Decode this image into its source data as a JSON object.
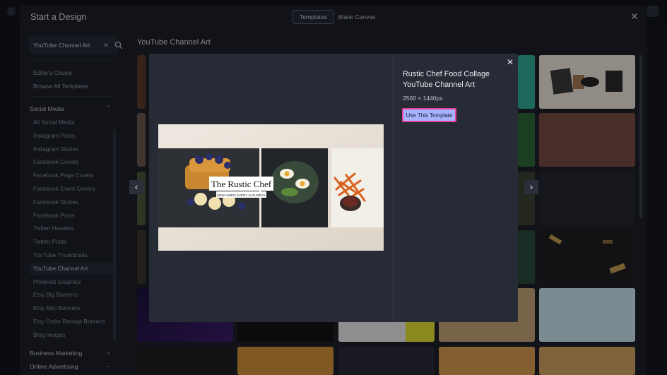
{
  "modal": {
    "title": "Start a Design",
    "tabs": [
      {
        "label": "Templates",
        "active": true
      },
      {
        "label": "Blank Canvas",
        "active": false
      }
    ]
  },
  "search": {
    "value": "YouTube Channel Art"
  },
  "sidebar": {
    "links": [
      "Editor's Choice",
      "Browse All Templates"
    ],
    "social_media": {
      "label": "Social Media",
      "items": [
        "All Social Media",
        "Instagram Posts",
        "Instagram Stories",
        "Facebook Covers",
        "Facebook Page Covers",
        "Facebook Event Covers",
        "Facebook Stories",
        "Facebook Posts",
        "Twitter Headers",
        "Twitter Posts",
        "YouTube Thumbnails",
        "YouTube Channel Art",
        "Pinterest Graphics",
        "Etsy Big Banners",
        "Etsy Mini Banners",
        "Etsy Order Receipt Banners",
        "Blog Images"
      ],
      "active_item": "YouTube Channel Art"
    },
    "collapsed_sections": [
      "Business Marketing",
      "Online Advertising"
    ]
  },
  "gallery": {
    "title": "YouTube Channel Art"
  },
  "preview": {
    "name": "Rustic Chef Food Collage YouTube Channel Art",
    "size": "2560 × 1440px",
    "use_button": "Use This Template",
    "image_title": "The Rustic Chef",
    "image_subtitle": "NEW VIDEO EVERY SATURDAY"
  },
  "colors": {
    "accent": "#a8b3ff",
    "accent_border": "#e8409a",
    "modal_bg": "#1b1e26",
    "preview_bg": "#272b36"
  }
}
